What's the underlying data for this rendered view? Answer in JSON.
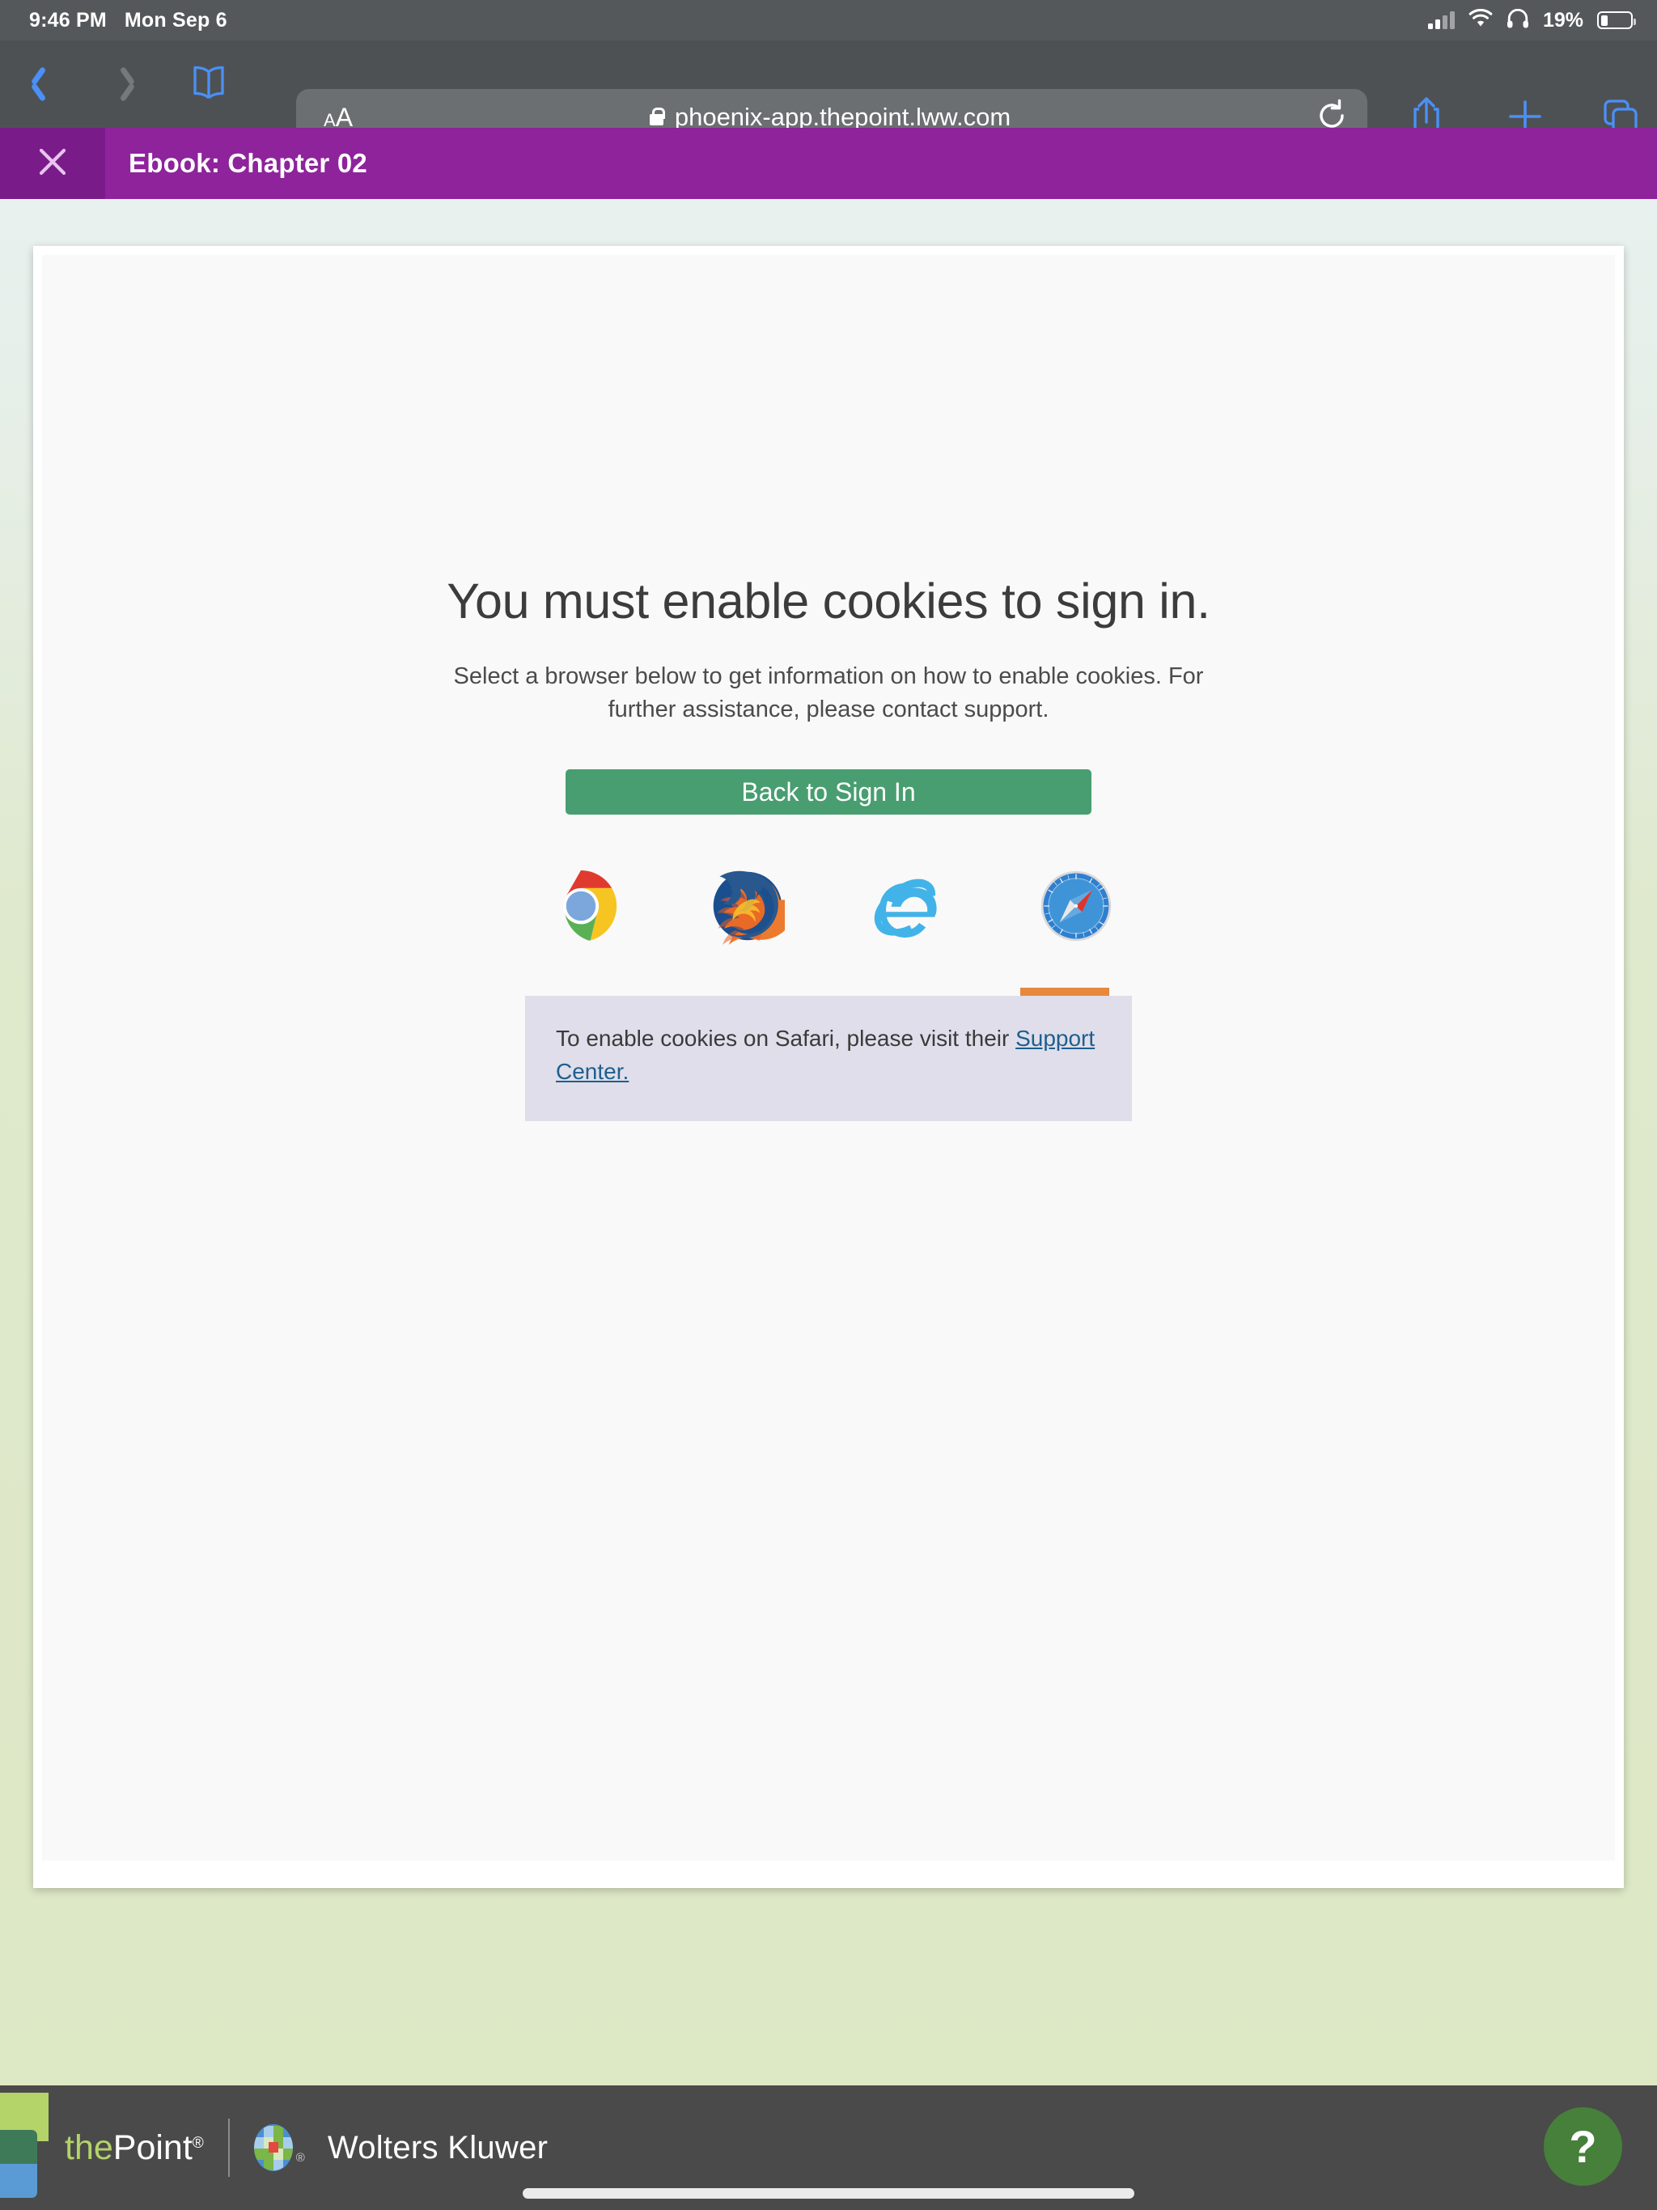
{
  "status_bar": {
    "time": "9:46 PM",
    "date": "Mon Sep 6",
    "battery_percent": "19%",
    "icons": [
      "cellular-signal-icon",
      "wifi-icon",
      "headphones-icon",
      "battery-icon"
    ]
  },
  "browser": {
    "back_icon": "chevron-left-icon",
    "forward_icon": "chevron-right-icon",
    "bookmarks_icon": "book-icon",
    "text_size_label_small": "A",
    "text_size_label_large": "A",
    "url": "phoenix-app.thepoint.lww.com",
    "lock_icon": "lock-icon",
    "reload_icon": "reload-icon",
    "share_icon": "share-icon",
    "new_tab_icon": "plus-icon",
    "tabs_icon": "tabs-icon"
  },
  "ebook_header": {
    "close_icon": "close-icon",
    "title": "Ebook: Chapter 02",
    "bar_color": "#8e239c",
    "close_bg_color": "#7a1b8a"
  },
  "main": {
    "heading": "You must enable cookies to sign in.",
    "subheading": "Select a browser below to get information on how to enable cookies. For further assistance, please contact support.",
    "primary_button": "Back to Sign In",
    "primary_button_color": "#489e70",
    "browsers": [
      {
        "name": "Chrome",
        "icon": "chrome-icon",
        "active": false
      },
      {
        "name": "Firefox",
        "icon": "firefox-icon",
        "active": false
      },
      {
        "name": "Internet Explorer",
        "icon": "internet-explorer-icon",
        "active": false
      },
      {
        "name": "Safari",
        "icon": "safari-icon",
        "active": true
      }
    ],
    "active_indicator_color": "#e8883c",
    "info_text_before_link": "To enable cookies on Safari, please visit their ",
    "info_link_text": "Support Center.",
    "info_panel_color": "#dfdeea"
  },
  "footer": {
    "the_point_the": "the",
    "the_point_point": "Point",
    "the_point_registered": "®",
    "wolters_kluwer": "Wolters Kluwer",
    "wolters_kluwer_registered": "®",
    "help_label": "?",
    "help_color": "#46803a",
    "bar_color": "#4a4a4a"
  }
}
